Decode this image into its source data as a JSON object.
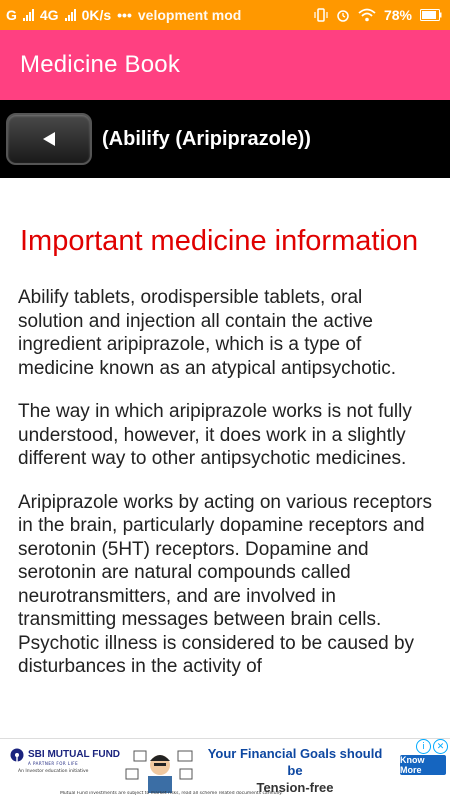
{
  "status_bar": {
    "carrier1": "G",
    "carrier2": "4G",
    "speed": "0K/s",
    "dots": "•••",
    "notification_text": "velopment mod",
    "battery": "78%"
  },
  "app_bar": {
    "title": "Medicine Book"
  },
  "sub_bar": {
    "back_icon": "play-left-icon",
    "heading": "(Abilify (Aripiprazole))"
  },
  "content": {
    "heading": "Important medicine information",
    "paragraphs": [
      "Abilify tablets, orodispersible tablets, oral solution and injection all contain the active ingredient aripiprazole, which is a type of medicine known as an atypical antipsychotic.",
      "The way in which aripiprazole works is not fully understood, however, it does work in a slightly different way to other antipsychotic medicines.",
      "Aripiprazole works by acting on various receptors in the brain, particularly dopamine receptors and serotonin (5HT) receptors. Dopamine and serotonin are natural compounds called neurotransmitters, and are involved in transmitting messages between brain cells. Psychotic illness is considered to be caused by disturbances in the activity of"
    ]
  },
  "ad": {
    "brand": "SBI MUTUAL FUND",
    "tagline": "A PARTNER FOR LIFE",
    "subtag": "An Investor education initiative",
    "headline_line1": "Your Financial Goals should be",
    "headline_line2": "Tension-free",
    "cta": "Know More",
    "disclaimer": "Mutual Fund investments are subject to market risks, read all scheme related documents carefully."
  }
}
